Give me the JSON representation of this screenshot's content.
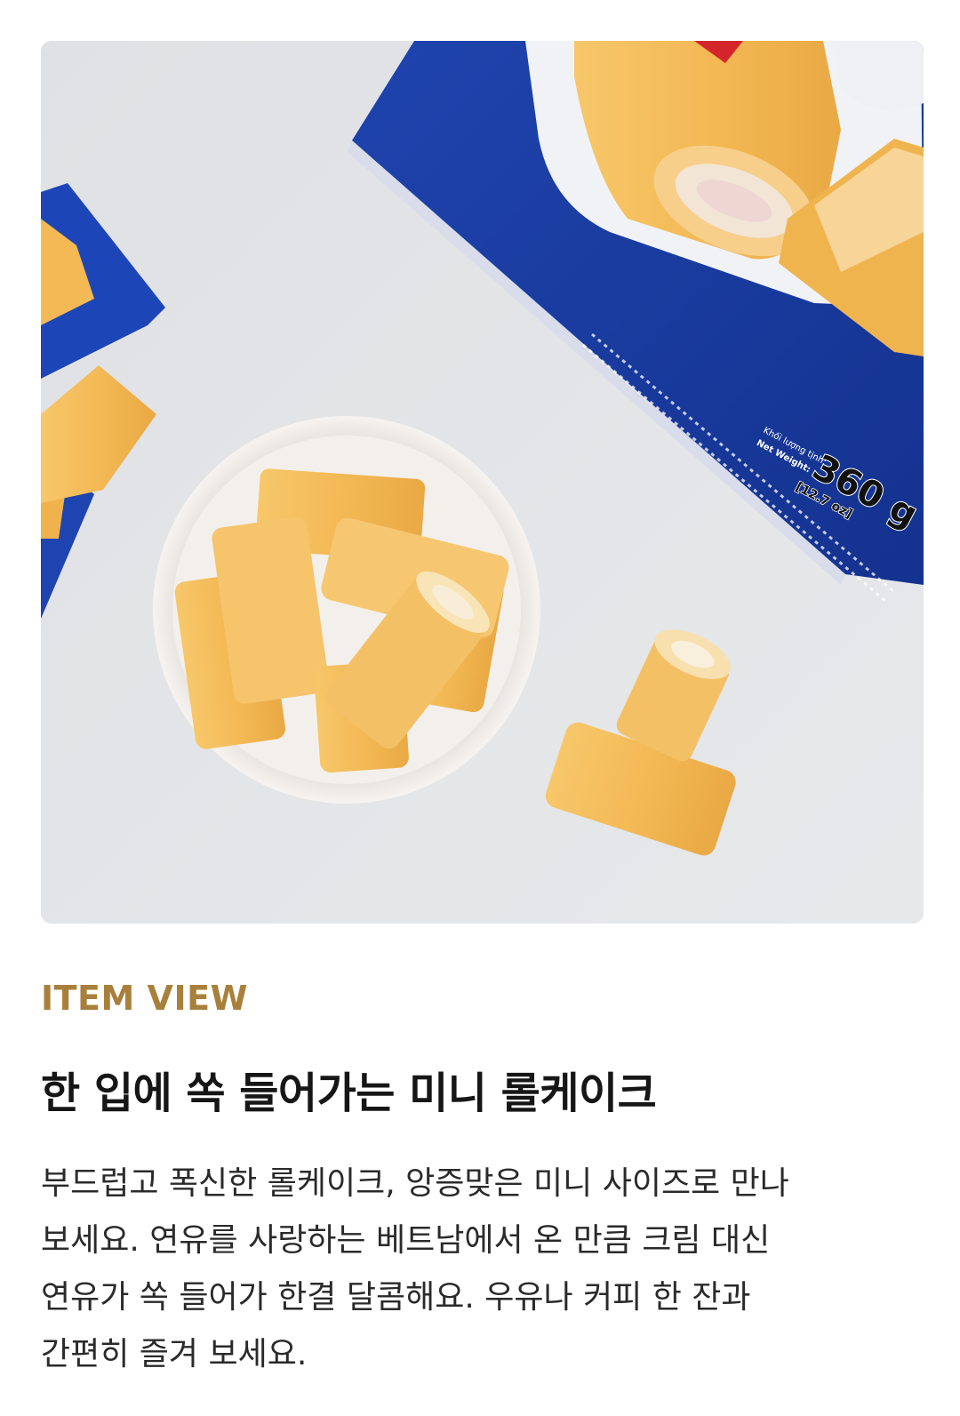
{
  "section": {
    "eyebrow": "ITEM VIEW",
    "headline": "한 입에 쏙 들어가는 미니 롤케이크",
    "body_lines": [
      "부드럽고 폭신한 롤케이크, 앙증맞은 미니 사이즈로 만나",
      "보세요. 연유를 사랑하는 베트남에서 온 만큼 크림 대신",
      "연유가 쏙 들어가 한결 달콤해요. 우유나 커피 한 잔과",
      "간편히 즐겨 보세요."
    ]
  },
  "package": {
    "label_vi": "Khối lượng tịnh:",
    "label_en": "Net Weight:",
    "weight": "360 g",
    "weight_oz": "[12.7 oz]"
  },
  "colors": {
    "accent": "#a9803b",
    "package_blue": "#1d3fa6",
    "cake": "#f3be5c"
  }
}
